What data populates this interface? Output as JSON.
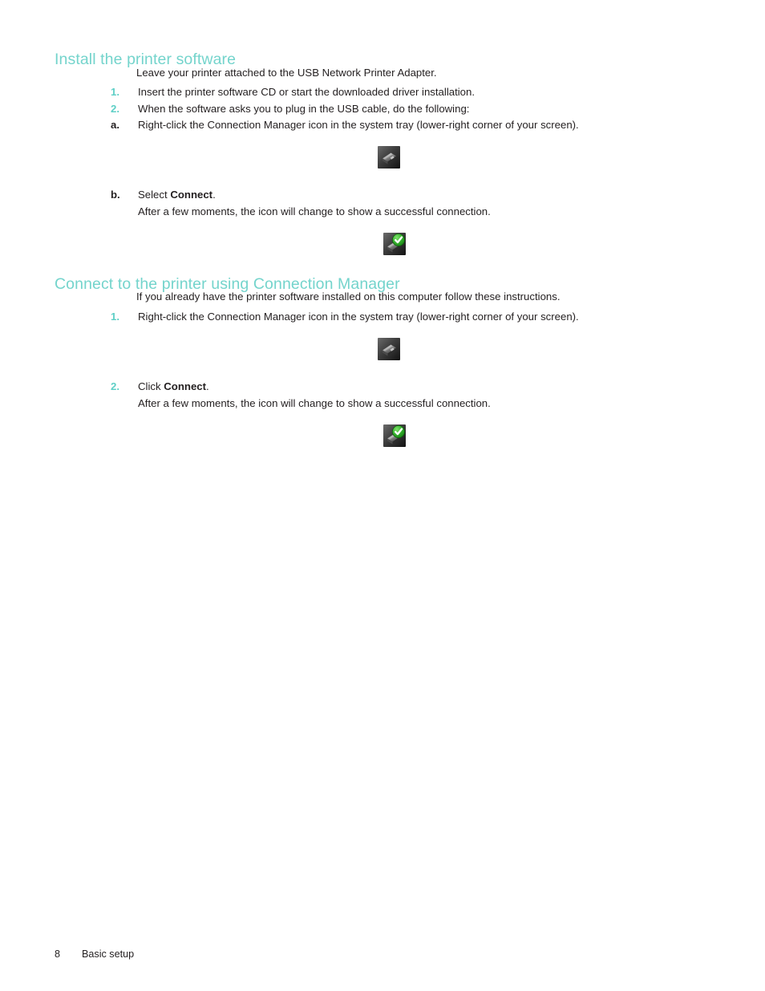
{
  "document": {
    "heading_color": "#74d4cc",
    "marker_color": "#5ecfc6",
    "body_color": "#231f20",
    "background": "#ffffff"
  },
  "sections": {
    "install": {
      "heading": "Install the printer software",
      "intro": "Leave your printer attached to the USB Network Printer Adapter.",
      "steps": [
        {
          "marker": "1.",
          "text": "Insert the printer software CD or start the downloaded driver installation."
        },
        {
          "marker": "2.",
          "text": "When the software asks you to plug in the USB cable, do the following:"
        }
      ],
      "substeps": [
        {
          "marker": "a.",
          "text": "Right-click the Connection Manager icon in the system tray (lower-right corner of your screen).",
          "text2": ""
        },
        {
          "marker": "b.",
          "text_prefix": "Select ",
          "text_bold": "Connect",
          "text_suffix": ".",
          "text2": "After a few moments, the icon will change to show a successful connection."
        }
      ]
    },
    "connect": {
      "heading": "Connect to the printer using Connection Manager",
      "intro": "If you already have the printer software installed on this computer follow these instructions.",
      "steps": [
        {
          "marker": "1.",
          "text": "Right-click the Connection Manager icon in the system tray (lower-right corner of your screen)."
        },
        {
          "marker": "2.",
          "text_prefix": "Click ",
          "text_bold": "Connect",
          "text_suffix": ".",
          "text2": "After a few moments, the icon will change to show a successful connection."
        }
      ]
    }
  },
  "icons": [
    {
      "name": "connection-manager-tray-icon-disconnected",
      "state": "disconnected"
    },
    {
      "name": "connection-manager-tray-icon-connected",
      "state": "connected"
    },
    {
      "name": "connection-manager-tray-icon-disconnected",
      "state": "disconnected"
    },
    {
      "name": "connection-manager-tray-icon-connected",
      "state": "connected"
    }
  ],
  "footer": {
    "page_number": "8",
    "section_name": "Basic setup"
  }
}
